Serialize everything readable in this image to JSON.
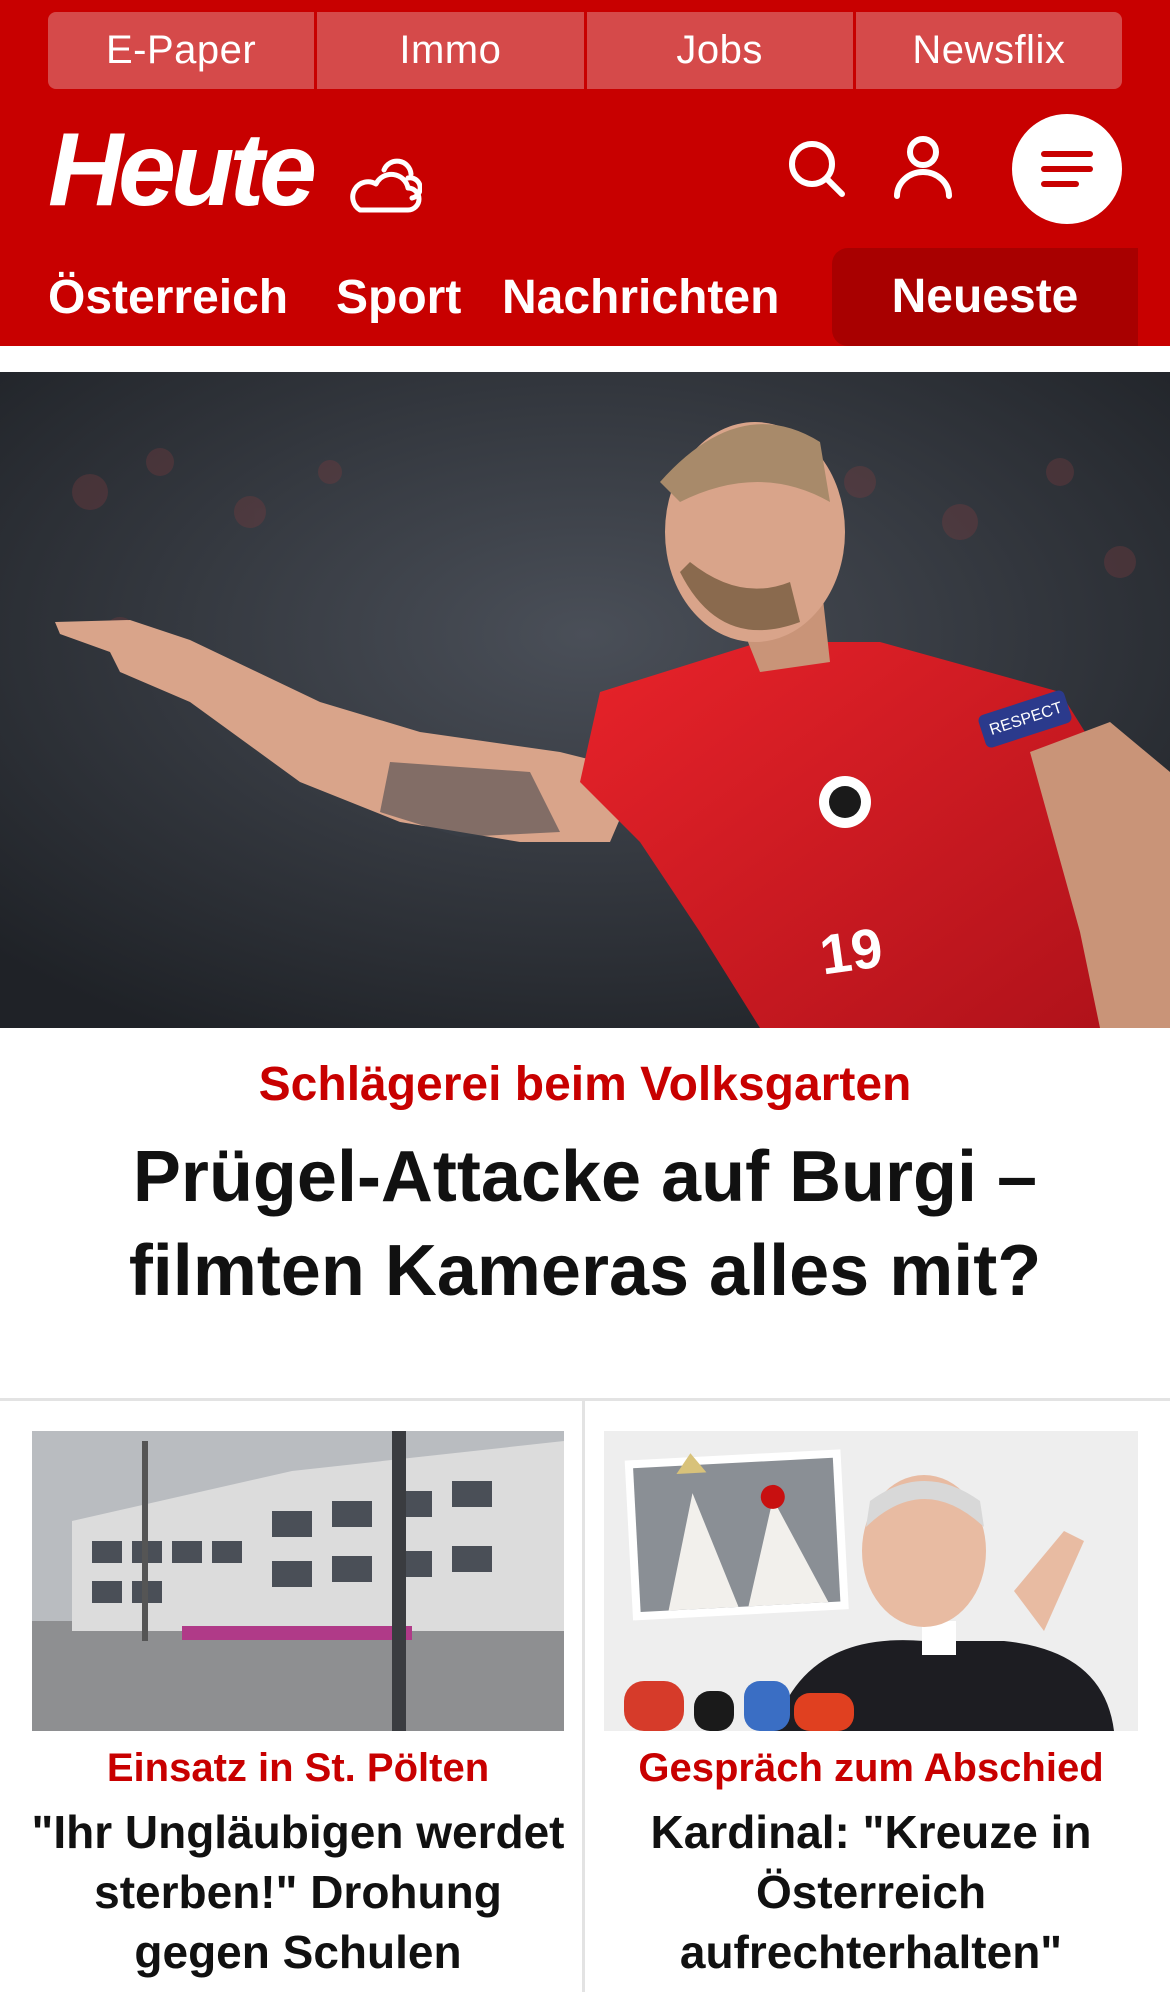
{
  "top_nav": [
    "E-Paper",
    "Immo",
    "Jobs",
    "Newsflix"
  ],
  "brand": {
    "logo_text": "Heute",
    "primary_color": "#c80000",
    "tab_active_color": "#a80000"
  },
  "icons": {
    "weather": "cloud-sun-icon",
    "search": "search-icon",
    "account": "user-icon",
    "menu": "menu-icon"
  },
  "section_nav": {
    "items": [
      "Österreich",
      "Sport",
      "Nachrichten"
    ],
    "active": "Neueste"
  },
  "hero": {
    "kicker": "Schlägerei beim Volksgarten",
    "headline": "Prügel-Attacke auf Burgi – filmten Kameras alles mit?",
    "image_text": {
      "jersey_number": "19",
      "armband": "RESPECT"
    }
  },
  "teasers": [
    {
      "kicker": "Einsatz in St. Pölten",
      "headline": "\"Ihr Ungläubigen werdet sterben!\" Drohung gegen Schulen"
    },
    {
      "kicker": "Gespräch zum Abschied",
      "headline": "Kardinal: \"Kreuze in Österreich aufrechterhalten\""
    }
  ]
}
